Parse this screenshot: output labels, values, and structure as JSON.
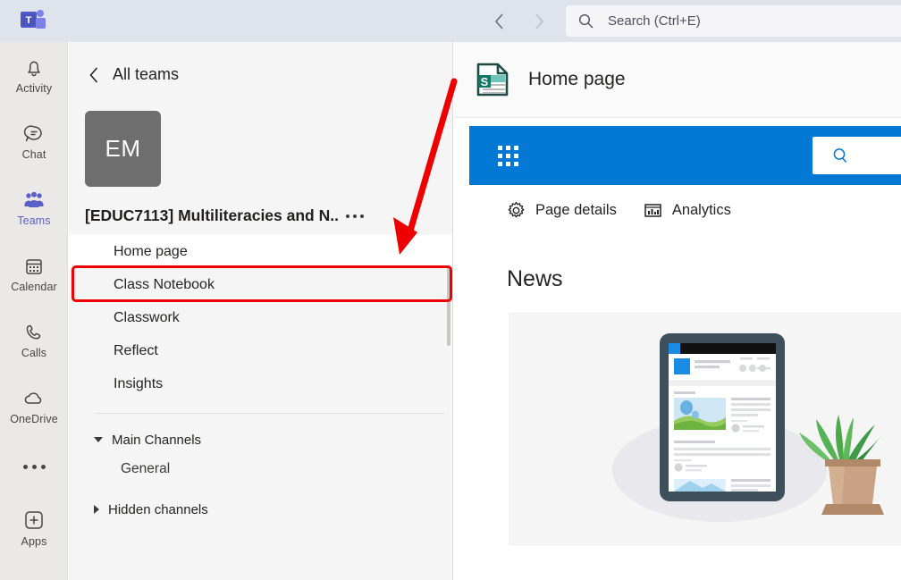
{
  "titlebar": {
    "logo_icon": "teams-logo-icon",
    "back_icon": "chevron-left-icon",
    "forward_icon": "chevron-right-icon",
    "search": {
      "icon": "search-icon",
      "placeholder": "Search (Ctrl+E)",
      "value": ""
    }
  },
  "rail": {
    "items": [
      {
        "label": "Activity",
        "icon": "bell-icon",
        "active": false
      },
      {
        "label": "Chat",
        "icon": "chat-bubble-icon",
        "active": false
      },
      {
        "label": "Teams",
        "icon": "teams-people-icon",
        "active": true
      },
      {
        "label": "Calendar",
        "icon": "calendar-icon",
        "active": false
      },
      {
        "label": "Calls",
        "icon": "phone-icon",
        "active": false
      },
      {
        "label": "OneDrive",
        "icon": "cloud-icon",
        "active": false
      }
    ],
    "more_icon": "more-horizontal-icon",
    "apps": {
      "label": "Apps",
      "icon": "plus-square-icon"
    }
  },
  "leftpanel": {
    "back_label": "All teams",
    "back_icon": "chevron-left-icon",
    "team_avatar_initials": "EM",
    "team_avatar_color": "#6e6e6e",
    "team_name": "[EDUC7113] Multiliteracies and N..",
    "team_more_icon": "more-horizontal-icon",
    "tabs": [
      {
        "label": "Home page",
        "selected": true
      },
      {
        "label": "Class Notebook",
        "selected": false
      },
      {
        "label": "Classwork",
        "selected": false
      },
      {
        "label": "Reflect",
        "selected": false
      },
      {
        "label": "Insights",
        "selected": false
      }
    ],
    "groups": [
      {
        "label": "Main Channels",
        "expanded": true,
        "children": [
          {
            "label": "General"
          }
        ]
      },
      {
        "label": "Hidden channels",
        "expanded": false,
        "children": []
      }
    ]
  },
  "main": {
    "tab_icon": "sharepoint-page-icon",
    "tab_title": "Home page",
    "sharepoint": {
      "bar_color": "#0078d4",
      "waffle_icon": "app-launcher-waffle-icon",
      "search_icon": "search-icon",
      "search_placeholder": "",
      "commands": [
        {
          "label": "Page details",
          "icon": "gear-icon"
        },
        {
          "label": "Analytics",
          "icon": "bar-chart-icon"
        }
      ],
      "news_heading": "News",
      "news_empty_illustration": "tablet-news-plant-illustration"
    }
  },
  "annotations": {
    "highlight_color": "#ee0000",
    "highlight_target": "Home page",
    "arrow_icon": "red-arrow-icon"
  }
}
